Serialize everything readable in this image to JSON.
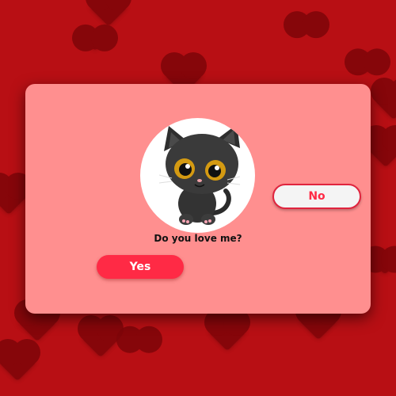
{
  "dialog": {
    "question": "Do you love me?",
    "yes_label": "Yes",
    "no_label": "No",
    "avatar_icon": "black-cat-icon"
  },
  "colors": {
    "background": "#b80f14",
    "card": "#ff8f8f",
    "accent": "#ff2a45"
  }
}
